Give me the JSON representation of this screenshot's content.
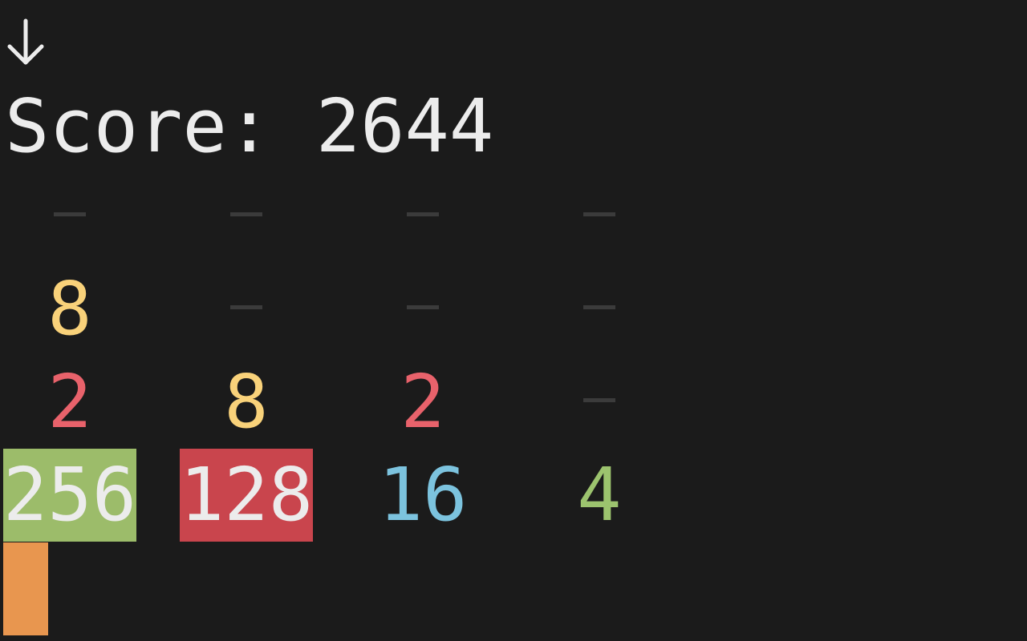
{
  "header": {
    "direction_icon": "arrow-down-icon",
    "score_text": "Score: 2644"
  },
  "board": {
    "rows": [
      [
        null,
        null,
        null,
        null
      ],
      [
        8,
        null,
        null,
        null
      ],
      [
        2,
        8,
        2,
        null
      ],
      [
        256,
        128,
        16,
        4
      ]
    ]
  },
  "colors": {
    "background": "#1b1b1b",
    "empty_dash": "#3b3b3b",
    "text_default": "#ececec",
    "tile_2": "#e8626b",
    "tile_4": "#9cc36e",
    "tile_8": "#f9d27a",
    "tile_16": "#7cc3de",
    "tile_128_bg": "#c9454d",
    "tile_256_bg": "#9cbc6a",
    "cursor": "#e8964f"
  }
}
